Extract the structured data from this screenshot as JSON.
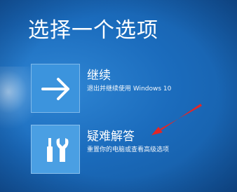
{
  "page": {
    "title": "选择一个选项"
  },
  "options": [
    {
      "label": "继续",
      "description": "退出并继续使用 Windows 10",
      "icon": "arrow-right-icon"
    },
    {
      "label": "疑难解答",
      "description": "重置你的电脑或查看高级选项",
      "icon": "tools-icon"
    }
  ],
  "annotation": {
    "icon": "red-pointer-arrow-icon",
    "color": "#e32626"
  },
  "colors": {
    "background": "#1868b7",
    "tile": "#3c94dd",
    "text": "#ffffff"
  }
}
